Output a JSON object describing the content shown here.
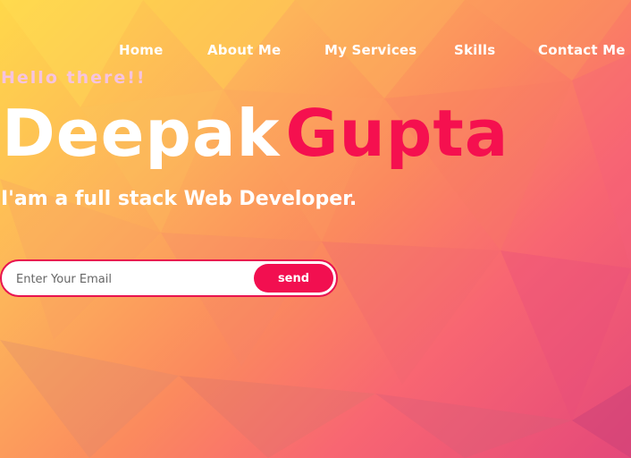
{
  "nav": {
    "items": [
      "Home",
      "About Me",
      "My Services",
      "Skills",
      "Contact Me"
    ]
  },
  "hero": {
    "greeting": "Hello there!!",
    "first_name": "Deepak",
    "last_name": "Gupta",
    "tagline": "I'am a full stack Web Developer."
  },
  "subscribe": {
    "placeholder": "Enter Your Email",
    "button_label": "send"
  },
  "colors": {
    "accent": "#f20f50",
    "greeting": "#f6c3df"
  }
}
